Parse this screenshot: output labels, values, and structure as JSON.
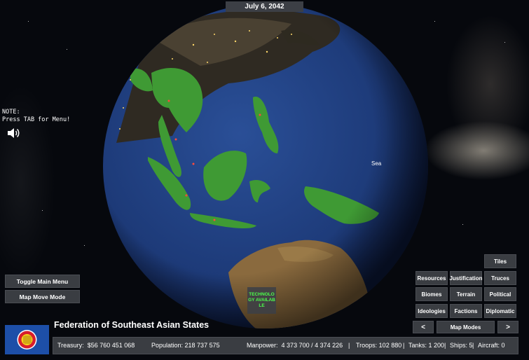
{
  "date": "July 6, 2042",
  "note": {
    "line1": "NOTE:",
    "line2": "Press TAB for Menu!"
  },
  "map_labels": {
    "sea": "Sea"
  },
  "tech_badge": "TECHNOLOGY AVAILABLE",
  "left_buttons": {
    "toggle_main_menu": "Toggle Main Menu",
    "map_move_mode": "Map Move Mode"
  },
  "map_mode_buttons": {
    "tiles": "Tiles",
    "resources": "Resources",
    "justification": "Justification",
    "truces": "Truces",
    "biomes": "Biomes",
    "terrain": "Terrain",
    "political": "Political",
    "ideologies": "Ideologies",
    "factions": "Factions",
    "diplomatic": "Diplomatic",
    "prev": "<",
    "map_modes": "Map Modes",
    "next": ">"
  },
  "nation": {
    "name": "Federation of Southeast Asian States"
  },
  "stats": {
    "treasury_label": "Treasury:",
    "treasury_value": "$56 760 451 068",
    "population": "Population: 218 737 575",
    "manpower_label": "Manpower:",
    "manpower_value": "4 373 700  /  4 374 226",
    "troops": "Troops: 102 880",
    "tanks": "Tanks: 1 200",
    "ships": "Ships: 5",
    "aircraft": "Aircraft: 0",
    "sep": "|"
  },
  "colors": {
    "button_bg": "#3a3d42",
    "land_green": "#3f9a34",
    "ocean": "#1f3b7a",
    "tech_green": "#4cff4c",
    "flag_blue": "#1d4fa8"
  },
  "icons": {
    "speaker": "speaker-icon",
    "flag": "asean-flag"
  }
}
